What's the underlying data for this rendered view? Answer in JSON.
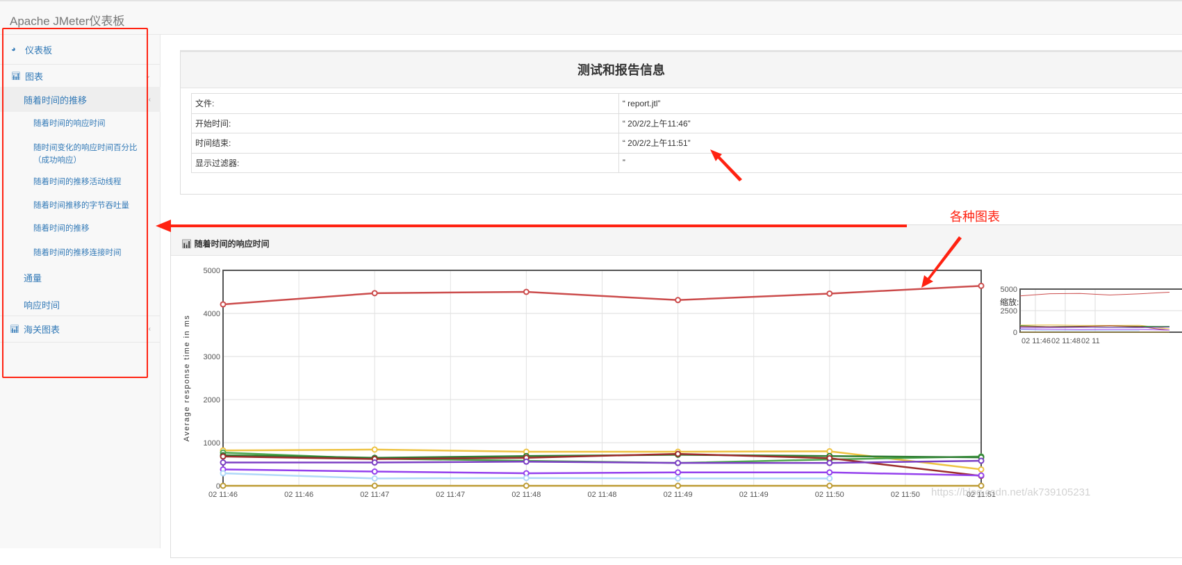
{
  "header": {
    "title": "Apache JMeter仪表板"
  },
  "sidebar": {
    "dashboard": "仪表板",
    "charts": "图表",
    "over_time": "随着时间的推移",
    "over_time_items": [
      "随着时间的响应时间",
      "随时间变化的响应时间百分比（成功响应）",
      "随着时间的推移活动线程",
      "随着时间推移的字节吞吐量",
      "随着时间的推移",
      "随着时间的推移连接时间"
    ],
    "throughput": "通量",
    "response_times": "响应时间",
    "custom_charts": "海关图表"
  },
  "info": {
    "title": "测试和报告信息",
    "rows": [
      {
        "k": "文件:",
        "v": "“ report.jtl”"
      },
      {
        "k": "开始时间:",
        "v": "“ 20/2/2上午11:46”"
      },
      {
        "k": "时间结束:",
        "v": "“ 20/2/2上午11:51”"
      },
      {
        "k": "显示过滤器:",
        "v": "”"
      }
    ]
  },
  "chart_panel": {
    "title": "随着时间的响应时间",
    "zoom_label": "缩放:"
  },
  "annotation": {
    "label": "各种图表",
    "color": "#ff2211"
  },
  "watermark": "https://blog.csdn.net/ak739105231",
  "chart_data": {
    "type": "line",
    "title": "随着时间的响应时间",
    "ylabel": "Average response time in ms",
    "xlabel": "",
    "ylim": [
      0,
      5000
    ],
    "yticks": [
      0,
      1000,
      2000,
      3000,
      4000,
      5000
    ],
    "xtick_labels": [
      "02 11:46",
      "02 11:46",
      "02 11:47",
      "02 11:47",
      "02 11:48",
      "02 11:48",
      "02 11:49",
      "02 11:49",
      "02 11:50",
      "02 11:50",
      "02 11:51"
    ],
    "x": [
      "02 11:46",
      "02 11:47",
      "02 11:48",
      "02 11:49",
      "02 11:50",
      "02 11:51"
    ],
    "series": [
      {
        "color": "#cb4b4b",
        "values": [
          4210,
          4470,
          4500,
          4310,
          4460,
          4640
        ]
      },
      {
        "color": "#edc240",
        "values": [
          820,
          840,
          790,
          790,
          800,
          380
        ]
      },
      {
        "color": "#4da74d",
        "values": [
          770,
          630,
          580,
          530,
          610,
          680
        ]
      },
      {
        "color": "#2e7d32",
        "values": [
          710,
          650,
          690,
          720,
          690,
          660
        ]
      },
      {
        "color": "#9c2b2b",
        "values": [
          680,
          620,
          650,
          740,
          640,
          230
        ]
      },
      {
        "color": "#7b3fc4",
        "values": [
          540,
          540,
          560,
          530,
          530,
          580
        ]
      },
      {
        "color": "#9440ed",
        "values": [
          380,
          330,
          290,
          310,
          310,
          240
        ]
      },
      {
        "color": "#afd8f8",
        "values": [
          290,
          170,
          180,
          170,
          170,
          null
        ]
      },
      {
        "color": "#bd9b33",
        "values": [
          0,
          0,
          0,
          0,
          0,
          0
        ]
      }
    ],
    "overview": {
      "yticks": [
        0,
        2500,
        5000
      ],
      "xtick_labels": [
        "02 11:46",
        "02 11:48",
        "02 11"
      ]
    }
  }
}
